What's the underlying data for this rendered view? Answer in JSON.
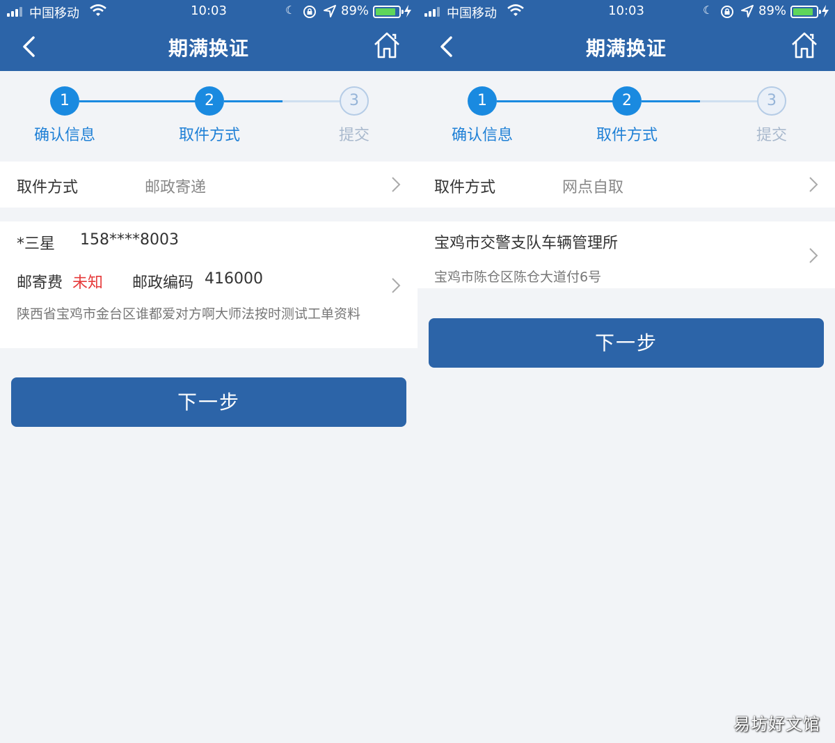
{
  "screens": [
    {
      "status": {
        "carrier": "中国移动",
        "time": "10:03",
        "battery": "89%",
        "battery_level": 0.89
      },
      "nav": {
        "title": "期满换证"
      },
      "steps": [
        {
          "num": "1",
          "label": "确认信息"
        },
        {
          "num": "2",
          "label": "取件方式"
        },
        {
          "num": "3",
          "label": "提交"
        }
      ],
      "pickup": {
        "label": "取件方式",
        "value": "邮政寄递"
      },
      "mail": {
        "name": "*三星",
        "phone": "158****8003",
        "fee_label": "邮寄费",
        "fee_value": "未知",
        "zip_label": "邮政编码",
        "zip_value": "416000",
        "address": "陕西省宝鸡市金台区谁都爱对方啊大师法按时测试工单资料"
      },
      "next_label": "下一步"
    },
    {
      "status": {
        "carrier": "中国移动",
        "time": "10:03",
        "battery": "89%",
        "battery_level": 0.89
      },
      "nav": {
        "title": "期满换证"
      },
      "steps": [
        {
          "num": "1",
          "label": "确认信息"
        },
        {
          "num": "2",
          "label": "取件方式"
        },
        {
          "num": "3",
          "label": "提交"
        }
      ],
      "pickup": {
        "label": "取件方式",
        "value": "网点自取"
      },
      "point": {
        "name": "宝鸡市交警支队车辆管理所",
        "address": "宝鸡市陈仓区陈仓大道付6号"
      },
      "next_label": "下一步"
    }
  ],
  "watermark": "易坊好文馆",
  "colors": {
    "header": "#2c64a8",
    "step_active": "#1a8ae0",
    "fee_unknown": "#e63b3b",
    "background": "#f2f4f7"
  }
}
